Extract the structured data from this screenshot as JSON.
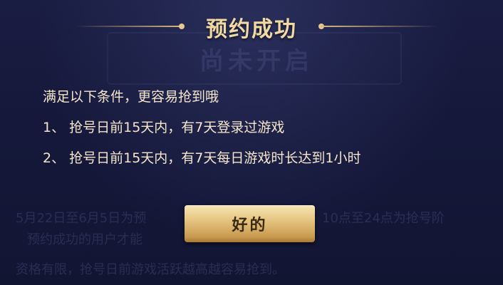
{
  "dialog": {
    "title": "预约成功",
    "lines": [
      "满足以下条件，更容易抢到哦",
      "1、 抢号日前15天内，有7天登录过游戏",
      "2、 抢号日前15天内，有7天每日游戏时长达到1小时"
    ],
    "ok_button": "好的"
  },
  "background": {
    "title": "尚未开启",
    "line1_left": "5月22日至6月5日为预",
    "line1_right": "10点至24点为抢号阶",
    "line2": "预约成功的用户才能",
    "line3": "资格有限，抢号日前游戏活跃越高越容易抢到。"
  },
  "colors": {
    "background": "#15183a",
    "title": "#f1d9a3",
    "text": "#f5e6cc",
    "button": "#e6c581"
  }
}
